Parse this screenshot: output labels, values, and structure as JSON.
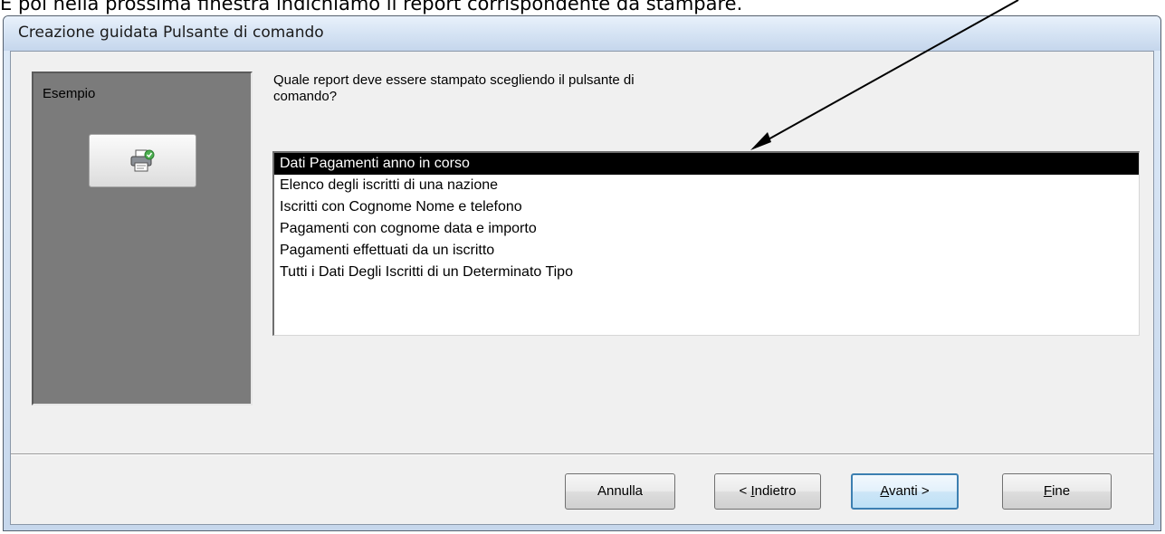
{
  "document": {
    "text": "E poi nella prossima finestra indichiamo il report corrispondente da stampare."
  },
  "dialog": {
    "title": "Creazione guidata Pulsante di comando",
    "example_label": "Esempio",
    "preview_icon": "printer-icon",
    "question_line1": "Quale report deve essere stampato scegliendo il pulsante di",
    "question_line2": "comando?",
    "reports": [
      "Dati Pagamenti anno in corso",
      "Elenco degli iscritti di una nazione",
      "Iscritti con Cognome Nome e telefono",
      "Pagamenti con cognome data e importo",
      "Pagamenti effettuati da un iscritto",
      "Tutti i Dati Degli Iscritti di un Determinato Tipo"
    ],
    "selected_report": "Dati Pagamenti anno in corso",
    "buttons": {
      "cancel": "Annulla",
      "back_prefix": "< ",
      "back_key": "I",
      "back_rest": "ndietro",
      "next_key": "A",
      "next_rest": "vanti >",
      "finish_key": "F",
      "finish_rest": "ine"
    }
  },
  "colors": {
    "selection_bg": "#000000",
    "panel_bg": "#7b7b7b",
    "default_button_border": "#3c7fb1",
    "annotation_arrow": "#000000"
  }
}
